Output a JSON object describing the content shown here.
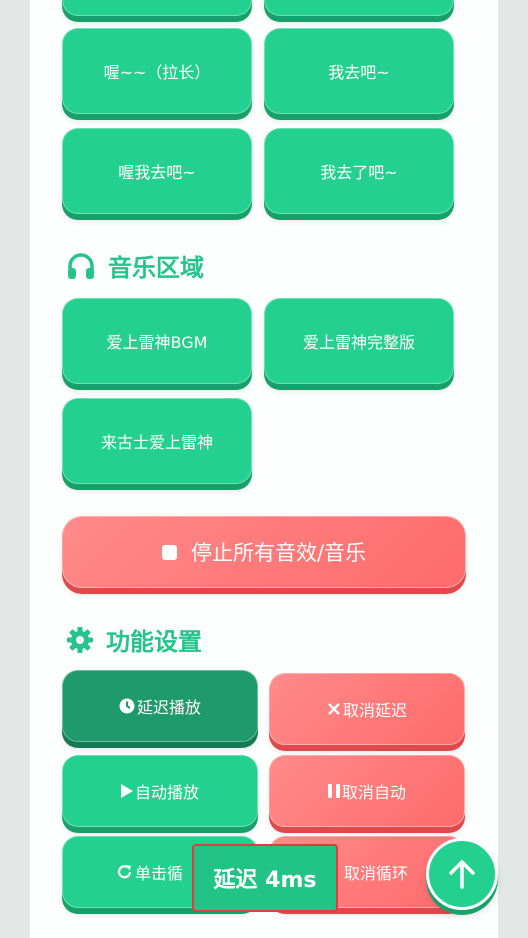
{
  "voice": {
    "row0": [
      "",
      ""
    ],
    "row1": [
      "喔~~（拉长）",
      "我去吧~"
    ],
    "row2": [
      "喔我去吧~",
      "我去了吧~"
    ]
  },
  "music": {
    "title": "音乐区域",
    "icon": "headphones-icon",
    "buttons": [
      "爱上雷神BGM",
      "爱上雷神完整版",
      "来古士爱上雷神"
    ]
  },
  "stop_all": {
    "label": "停止所有音效/音乐",
    "icon": "stop-icon"
  },
  "settings": {
    "title": "功能设置",
    "icon": "gear-icon",
    "delay_play": "延迟播放",
    "cancel_delay": "取消延迟",
    "auto_play": "自动播放",
    "cancel_auto": "取消自动",
    "single_loop": "单击循",
    "cancel_loop": "取消循环"
  },
  "toast": {
    "text": "延迟 4ms"
  },
  "colors": {
    "green": "#24d08f",
    "green_dark": "#1e9a6c",
    "red": "#ff6b6b",
    "accent_text": "#24c48a"
  }
}
